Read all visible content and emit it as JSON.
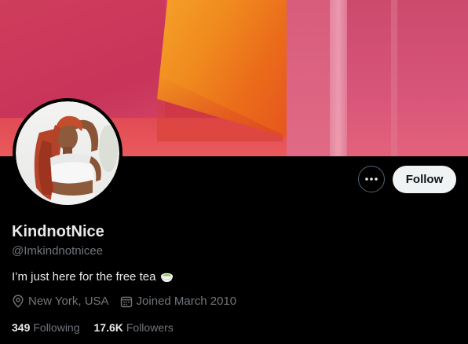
{
  "profile": {
    "display_name": "KindnotNice",
    "handle": "@Imkindnotnicee",
    "bio": "I’m just here for the free tea",
    "bio_emoji": "matcha-tea-emoji",
    "location": "New York, USA",
    "joined": "Joined March 2010",
    "following_count": "349",
    "following_label": "Following",
    "followers_count": "17.6K",
    "followers_label": "Followers"
  },
  "actions": {
    "more_label": "•••",
    "follow_label": "Follow"
  },
  "icons": {
    "location": "location-pin-icon",
    "calendar": "calendar-icon",
    "more": "more-options-icon"
  },
  "colors": {
    "background": "#000000",
    "primary_text": "#e7e9ea",
    "secondary_text": "#71767b",
    "follow_button_bg": "#eff3f4",
    "follow_button_text": "#0f1419",
    "border": "#536471"
  }
}
